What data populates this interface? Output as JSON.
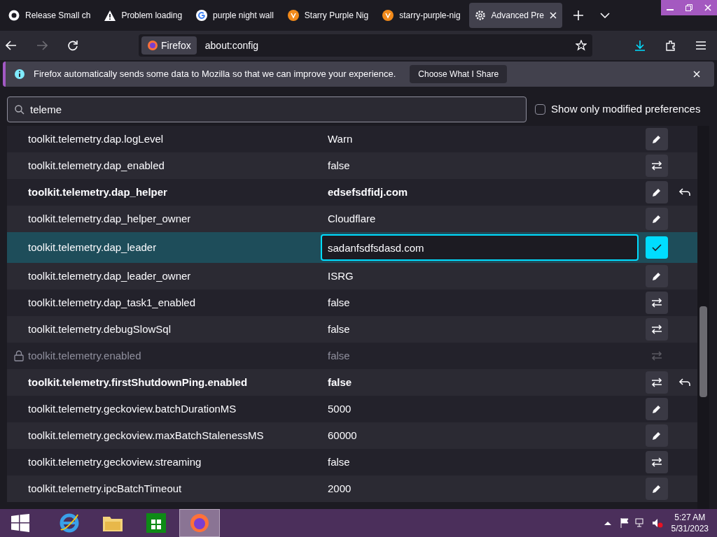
{
  "tabs": [
    {
      "title": "Release Small ch",
      "selected": false
    },
    {
      "title": "Problem loading",
      "selected": false
    },
    {
      "title": "purple night wall",
      "selected": false
    },
    {
      "title": "Starry Purple Nig",
      "selected": false
    },
    {
      "title": "starry-purple-nig",
      "selected": false
    },
    {
      "title": "Advanced Pre",
      "selected": true
    }
  ],
  "toolbar": {
    "identity": "Firefox",
    "url": "about:config"
  },
  "notification": {
    "message": "Firefox automatically sends some data to Mozilla so that we can improve your experience.",
    "button": "Choose What I Share"
  },
  "search": {
    "value": "teleme"
  },
  "modified_only": {
    "label": "Show only modified preferences",
    "checked": false
  },
  "rows": [
    {
      "name": "toolkit.telemetry.dap.logLevel",
      "value": "Warn",
      "kind": "text",
      "modified": false,
      "locked": false,
      "editing": false
    },
    {
      "name": "toolkit.telemetry.dap_enabled",
      "value": "false",
      "kind": "bool",
      "modified": false,
      "locked": false,
      "editing": false
    },
    {
      "name": "toolkit.telemetry.dap_helper",
      "value": "edsefsdfidj.com",
      "kind": "text",
      "modified": true,
      "locked": false,
      "editing": false
    },
    {
      "name": "toolkit.telemetry.dap_helper_owner",
      "value": "Cloudflare",
      "kind": "text",
      "modified": false,
      "locked": false,
      "editing": false
    },
    {
      "name": "toolkit.telemetry.dap_leader",
      "value": "sadanfsdfsdasd.com",
      "kind": "text",
      "modified": false,
      "locked": false,
      "editing": true
    },
    {
      "name": "toolkit.telemetry.dap_leader_owner",
      "value": "ISRG",
      "kind": "text",
      "modified": false,
      "locked": false,
      "editing": false
    },
    {
      "name": "toolkit.telemetry.dap_task1_enabled",
      "value": "false",
      "kind": "bool",
      "modified": false,
      "locked": false,
      "editing": false
    },
    {
      "name": "toolkit.telemetry.debugSlowSql",
      "value": "false",
      "kind": "bool",
      "modified": false,
      "locked": false,
      "editing": false
    },
    {
      "name": "toolkit.telemetry.enabled",
      "value": "false",
      "kind": "bool",
      "modified": false,
      "locked": true,
      "editing": false
    },
    {
      "name": "toolkit.telemetry.firstShutdownPing.enabled",
      "value": "false",
      "kind": "bool",
      "modified": true,
      "locked": false,
      "editing": false
    },
    {
      "name": "toolkit.telemetry.geckoview.batchDurationMS",
      "value": "5000",
      "kind": "text",
      "modified": false,
      "locked": false,
      "editing": false
    },
    {
      "name": "toolkit.telemetry.geckoview.maxBatchStalenessMS",
      "value": "60000",
      "kind": "text",
      "modified": false,
      "locked": false,
      "editing": false
    },
    {
      "name": "toolkit.telemetry.geckoview.streaming",
      "value": "false",
      "kind": "bool",
      "modified": false,
      "locked": false,
      "editing": false
    },
    {
      "name": "toolkit.telemetry.ipcBatchTimeout",
      "value": "2000",
      "kind": "text",
      "modified": false,
      "locked": false,
      "editing": false
    }
  ],
  "taskbar": {
    "apps": [
      {
        "selected": false
      },
      {
        "selected": false
      },
      {
        "selected": false
      },
      {
        "selected": true
      }
    ],
    "time": "5:27 AM",
    "date": "5/31/2023"
  }
}
